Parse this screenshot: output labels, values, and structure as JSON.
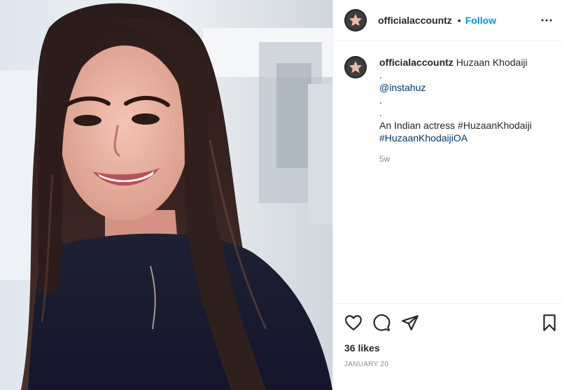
{
  "post": {
    "image_alt": "Photo of a smiling woman with long dark hair",
    "header": {
      "username": "officialaccountz",
      "separator": "•",
      "follow_label": "Follow",
      "avatar_icon": "star-icon",
      "more_icon": "more-options-icon"
    },
    "caption": {
      "username": "officialaccountz",
      "title": "Huzaan Khodaiji",
      "lines": [
        ".",
        "@instahuz",
        ".",
        ".",
        "An Indian actress #HuzaanKhodaiji",
        "#HuzaanKhodaijiOA"
      ],
      "time": "5w"
    },
    "actions": {
      "like_icon": "heart-icon",
      "comment_icon": "comment-icon",
      "share_icon": "share-icon",
      "save_icon": "bookmark-icon"
    },
    "likes": "36 likes",
    "date": "JANUARY 20"
  },
  "colors": {
    "follow": "#0095f6",
    "secondary_text": "#8e8e8e",
    "border": "#efefef"
  }
}
